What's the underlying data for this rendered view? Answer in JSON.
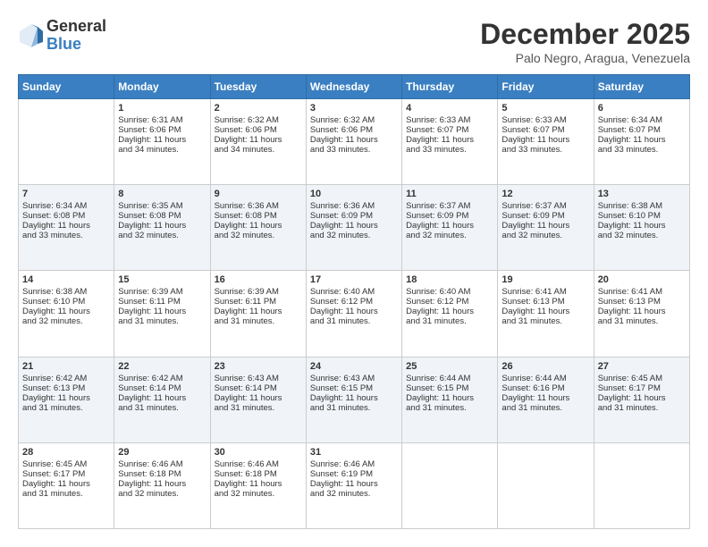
{
  "logo": {
    "general": "General",
    "blue": "Blue"
  },
  "title": "December 2025",
  "subtitle": "Palo Negro, Aragua, Venezuela",
  "days_of_week": [
    "Sunday",
    "Monday",
    "Tuesday",
    "Wednesday",
    "Thursday",
    "Friday",
    "Saturday"
  ],
  "weeks": [
    [
      {
        "day": "",
        "info": ""
      },
      {
        "day": "1",
        "info": "Sunrise: 6:31 AM\nSunset: 6:06 PM\nDaylight: 11 hours\nand 34 minutes."
      },
      {
        "day": "2",
        "info": "Sunrise: 6:32 AM\nSunset: 6:06 PM\nDaylight: 11 hours\nand 34 minutes."
      },
      {
        "day": "3",
        "info": "Sunrise: 6:32 AM\nSunset: 6:06 PM\nDaylight: 11 hours\nand 33 minutes."
      },
      {
        "day": "4",
        "info": "Sunrise: 6:33 AM\nSunset: 6:07 PM\nDaylight: 11 hours\nand 33 minutes."
      },
      {
        "day": "5",
        "info": "Sunrise: 6:33 AM\nSunset: 6:07 PM\nDaylight: 11 hours\nand 33 minutes."
      },
      {
        "day": "6",
        "info": "Sunrise: 6:34 AM\nSunset: 6:07 PM\nDaylight: 11 hours\nand 33 minutes."
      }
    ],
    [
      {
        "day": "7",
        "info": "Sunrise: 6:34 AM\nSunset: 6:08 PM\nDaylight: 11 hours\nand 33 minutes."
      },
      {
        "day": "8",
        "info": "Sunrise: 6:35 AM\nSunset: 6:08 PM\nDaylight: 11 hours\nand 32 minutes."
      },
      {
        "day": "9",
        "info": "Sunrise: 6:36 AM\nSunset: 6:08 PM\nDaylight: 11 hours\nand 32 minutes."
      },
      {
        "day": "10",
        "info": "Sunrise: 6:36 AM\nSunset: 6:09 PM\nDaylight: 11 hours\nand 32 minutes."
      },
      {
        "day": "11",
        "info": "Sunrise: 6:37 AM\nSunset: 6:09 PM\nDaylight: 11 hours\nand 32 minutes."
      },
      {
        "day": "12",
        "info": "Sunrise: 6:37 AM\nSunset: 6:09 PM\nDaylight: 11 hours\nand 32 minutes."
      },
      {
        "day": "13",
        "info": "Sunrise: 6:38 AM\nSunset: 6:10 PM\nDaylight: 11 hours\nand 32 minutes."
      }
    ],
    [
      {
        "day": "14",
        "info": "Sunrise: 6:38 AM\nSunset: 6:10 PM\nDaylight: 11 hours\nand 32 minutes."
      },
      {
        "day": "15",
        "info": "Sunrise: 6:39 AM\nSunset: 6:11 PM\nDaylight: 11 hours\nand 31 minutes."
      },
      {
        "day": "16",
        "info": "Sunrise: 6:39 AM\nSunset: 6:11 PM\nDaylight: 11 hours\nand 31 minutes."
      },
      {
        "day": "17",
        "info": "Sunrise: 6:40 AM\nSunset: 6:12 PM\nDaylight: 11 hours\nand 31 minutes."
      },
      {
        "day": "18",
        "info": "Sunrise: 6:40 AM\nSunset: 6:12 PM\nDaylight: 11 hours\nand 31 minutes."
      },
      {
        "day": "19",
        "info": "Sunrise: 6:41 AM\nSunset: 6:13 PM\nDaylight: 11 hours\nand 31 minutes."
      },
      {
        "day": "20",
        "info": "Sunrise: 6:41 AM\nSunset: 6:13 PM\nDaylight: 11 hours\nand 31 minutes."
      }
    ],
    [
      {
        "day": "21",
        "info": "Sunrise: 6:42 AM\nSunset: 6:13 PM\nDaylight: 11 hours\nand 31 minutes."
      },
      {
        "day": "22",
        "info": "Sunrise: 6:42 AM\nSunset: 6:14 PM\nDaylight: 11 hours\nand 31 minutes."
      },
      {
        "day": "23",
        "info": "Sunrise: 6:43 AM\nSunset: 6:14 PM\nDaylight: 11 hours\nand 31 minutes."
      },
      {
        "day": "24",
        "info": "Sunrise: 6:43 AM\nSunset: 6:15 PM\nDaylight: 11 hours\nand 31 minutes."
      },
      {
        "day": "25",
        "info": "Sunrise: 6:44 AM\nSunset: 6:15 PM\nDaylight: 11 hours\nand 31 minutes."
      },
      {
        "day": "26",
        "info": "Sunrise: 6:44 AM\nSunset: 6:16 PM\nDaylight: 11 hours\nand 31 minutes."
      },
      {
        "day": "27",
        "info": "Sunrise: 6:45 AM\nSunset: 6:17 PM\nDaylight: 11 hours\nand 31 minutes."
      }
    ],
    [
      {
        "day": "28",
        "info": "Sunrise: 6:45 AM\nSunset: 6:17 PM\nDaylight: 11 hours\nand 31 minutes."
      },
      {
        "day": "29",
        "info": "Sunrise: 6:46 AM\nSunset: 6:18 PM\nDaylight: 11 hours\nand 32 minutes."
      },
      {
        "day": "30",
        "info": "Sunrise: 6:46 AM\nSunset: 6:18 PM\nDaylight: 11 hours\nand 32 minutes."
      },
      {
        "day": "31",
        "info": "Sunrise: 6:46 AM\nSunset: 6:19 PM\nDaylight: 11 hours\nand 32 minutes."
      },
      {
        "day": "",
        "info": ""
      },
      {
        "day": "",
        "info": ""
      },
      {
        "day": "",
        "info": ""
      }
    ]
  ]
}
